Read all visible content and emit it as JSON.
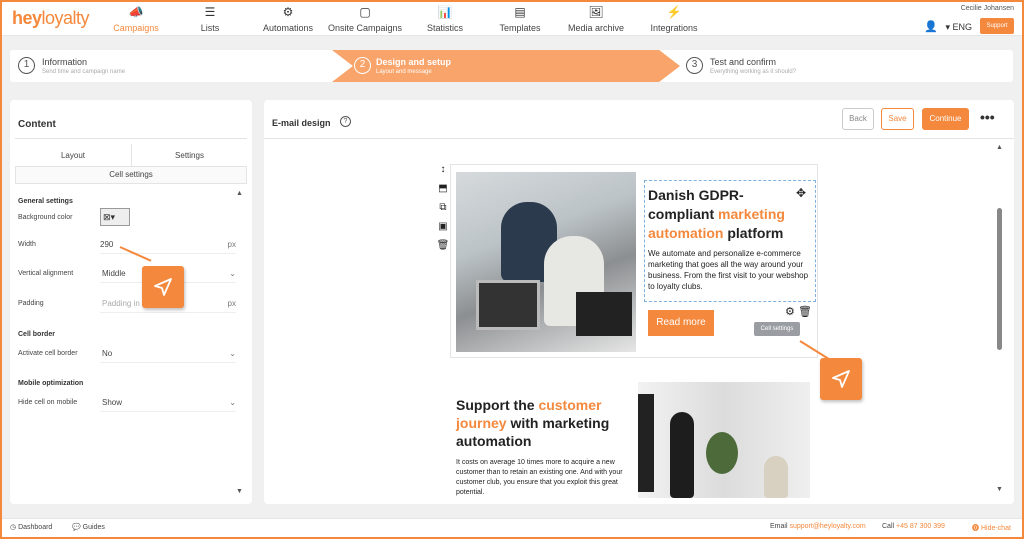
{
  "brand": {
    "hey": "hey",
    "loyalty": "loyalty"
  },
  "nav": [
    {
      "label": "Campaigns",
      "icon": "megaphone-icon",
      "glyph": "📣"
    },
    {
      "label": "Lists",
      "icon": "list-icon",
      "glyph": "☰"
    },
    {
      "label": "Automations",
      "icon": "gears-icon",
      "glyph": "⚙"
    },
    {
      "label": "Onsite Campaigns",
      "icon": "window-icon",
      "glyph": "▢"
    },
    {
      "label": "Statistics",
      "icon": "chart-icon",
      "glyph": "📊"
    },
    {
      "label": "Templates",
      "icon": "template-icon",
      "glyph": "▤"
    },
    {
      "label": "Media archive",
      "icon": "image-icon",
      "glyph": "🖼"
    },
    {
      "label": "Integrations",
      "icon": "plug-icon",
      "glyph": "⚡"
    }
  ],
  "user": {
    "name": "Cecilie Johansen",
    "language": "ENG",
    "support_label": "Support"
  },
  "steps": [
    {
      "num": "1",
      "title": "Information",
      "subtitle": "Send time and campaign name"
    },
    {
      "num": "2",
      "title": "Design and setup",
      "subtitle": "Layout and message"
    },
    {
      "num": "3",
      "title": "Test and confirm",
      "subtitle": "Everything working as it should?"
    }
  ],
  "left_panel": {
    "title": "Content",
    "tabs": {
      "layout": "Layout",
      "settings": "Settings",
      "cell_settings": "Cell settings"
    },
    "general_settings": "General settings",
    "background_color_label": "Background color",
    "width_label": "Width",
    "width_value": "290",
    "width_unit": "px",
    "vertical_alignment_label": "Vertical alignment",
    "vertical_alignment_value": "Middle",
    "padding_label": "Padding",
    "padding_placeholder": "Padding in",
    "padding_unit": "px",
    "cell_border": "Cell border",
    "activate_cell_border_label": "Activate cell border",
    "activate_cell_border_value": "No",
    "mobile_optimization": "Mobile optimization",
    "hide_cell_label": "Hide cell on mobile",
    "hide_cell_value": "Show"
  },
  "right_panel": {
    "title": "E-mail design",
    "back": "Back",
    "save": "Save",
    "continue": "Continue"
  },
  "email": {
    "headline1_a": "Danish GDPR-compliant ",
    "headline1_b": "marketing automation",
    "headline1_c": " platform",
    "body1": "We automate and personalize e-commerce marketing that goes all the way around your business. From the first visit to your webshop to loyalty clubs.",
    "read_more": "Read more",
    "cell_settings_tooltip": "Cell settings",
    "headline2_a": "Support the ",
    "headline2_b": "customer journey",
    "headline2_c": " with marketing automation",
    "body2": "It costs on average 10 times more to acquire a new customer than to retain an existing one. And with your customer club, you ensure that you exploit this great potential."
  },
  "footer": {
    "dashboard": "Dashboard",
    "guides": "Guides",
    "email_label": "Email",
    "email_value": "support@heyloyalty.com",
    "call_label": "Call",
    "call_value": "+45 87 300 399",
    "hide_chat": "Hide-chat"
  },
  "colors": {
    "accent": "#f4883c",
    "accent_light": "#f8a46a"
  }
}
